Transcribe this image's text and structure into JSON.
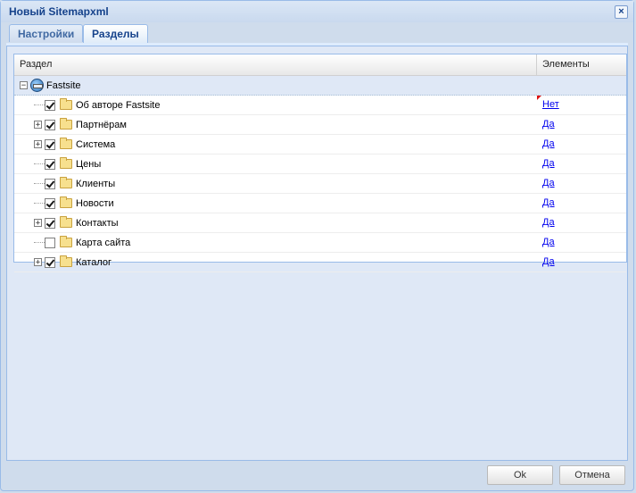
{
  "window": {
    "title": "Новый Sitemapxml"
  },
  "tabs": [
    {
      "label": "Настройки",
      "active": false
    },
    {
      "label": "Разделы",
      "active": true
    }
  ],
  "grid": {
    "columns": [
      "Раздел",
      "Элементы"
    ],
    "root": {
      "label": "Fastsite"
    },
    "rows": [
      {
        "label": "Об авторе Fastsite",
        "checked": true,
        "expandable": false,
        "elements": "Нет",
        "modified": true
      },
      {
        "label": "Партнёрам",
        "checked": true,
        "expandable": true,
        "elements": "Да",
        "modified": false
      },
      {
        "label": "Система",
        "checked": true,
        "expandable": true,
        "elements": "Да",
        "modified": false
      },
      {
        "label": "Цены",
        "checked": true,
        "expandable": false,
        "elements": "Да",
        "modified": false
      },
      {
        "label": "Клиенты",
        "checked": true,
        "expandable": false,
        "elements": "Да",
        "modified": false
      },
      {
        "label": "Новости",
        "checked": true,
        "expandable": false,
        "elements": "Да",
        "modified": false
      },
      {
        "label": "Контакты",
        "checked": true,
        "expandable": true,
        "elements": "Да",
        "modified": false
      },
      {
        "label": "Карта сайта",
        "checked": false,
        "expandable": false,
        "elements": "Да",
        "modified": false
      },
      {
        "label": "Каталог",
        "checked": true,
        "expandable": true,
        "elements": "Да",
        "modified": false
      }
    ]
  },
  "footer": {
    "ok_label": "Ok",
    "cancel_label": "Отмена"
  },
  "colors": {
    "title_text": "#15428b",
    "accent_border": "#99bbe8",
    "link": "#0000ee"
  },
  "icons": {
    "close": "close-icon",
    "root": "site-icon",
    "folder": "folder-icon",
    "expand": "plus-icon",
    "collapse": "minus-icon"
  }
}
